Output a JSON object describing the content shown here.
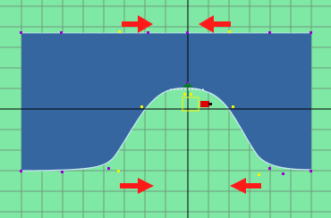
{
  "editor": {
    "background_color": "#7fe8a4",
    "grid_color": "#6c9c7d",
    "axis_color": "#000000",
    "shape_fill": "#3566a0",
    "shape_edge": "#ffffff",
    "arrow_color": "#ff1a1a",
    "handle_colors": {
      "vertex": "#9a00d6",
      "control": "#f4f400",
      "selected_marker": "#e00000",
      "pivot": "#0a7a2a"
    }
  },
  "arrows": {
    "top_left": "arrow-right",
    "top_right": "arrow-left",
    "bottom_left": "arrow-right",
    "bottom_right": "arrow-left"
  }
}
